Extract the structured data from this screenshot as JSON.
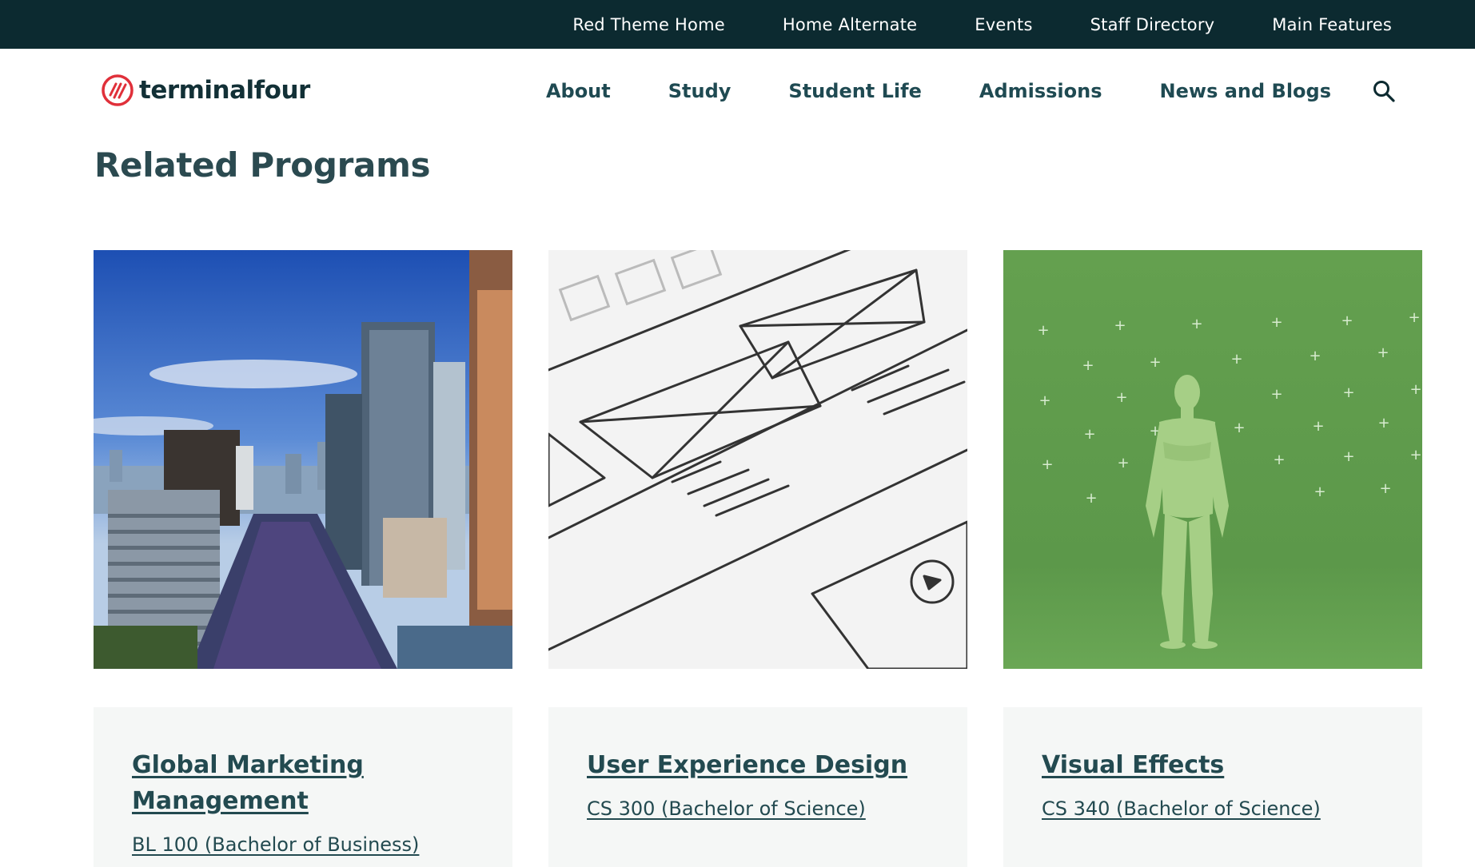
{
  "utility_nav": {
    "items": [
      {
        "label": "Red Theme Home"
      },
      {
        "label": "Home Alternate"
      },
      {
        "label": "Events"
      },
      {
        "label": "Staff Directory"
      },
      {
        "label": "Main Features"
      }
    ]
  },
  "header": {
    "logo_text": "terminalfour",
    "nav": [
      {
        "label": "About"
      },
      {
        "label": "Study"
      },
      {
        "label": "Student Life"
      },
      {
        "label": "Admissions"
      },
      {
        "label": "News and Blogs"
      }
    ],
    "search_icon": "search-icon"
  },
  "section": {
    "title": "Related Programs"
  },
  "cards": [
    {
      "title": "Global Marketing Management",
      "code": "BL 100 (Bachelor of Business)",
      "image": "city-skyline-image"
    },
    {
      "title": "User Experience Design",
      "code": "CS 300 (Bachelor of Science)",
      "image": "wireframe-sketch-image"
    },
    {
      "title": "Visual Effects",
      "code": "CS 340 (Bachelor of Science)",
      "image": "green-screen-figure-image"
    }
  ],
  "colors": {
    "utility_bar": "#0c2a30",
    "brand_red": "#e0303a",
    "text_teal": "#234a50",
    "card_bg": "#f5f7f6",
    "green_screen": "#5f9a4c"
  }
}
